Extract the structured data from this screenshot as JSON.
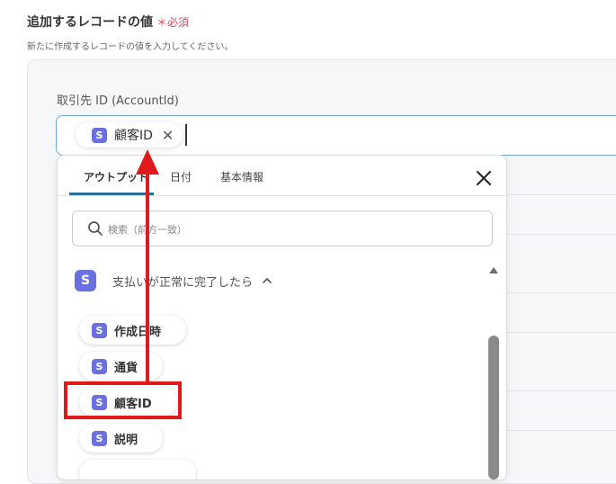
{
  "header": {
    "title": "追加するレコードの値",
    "required_mark": "＊必須",
    "subtitle": "新たに作成するレコードの値を入力してください。"
  },
  "field": {
    "label": "取引先 ID (AccountId)",
    "token": {
      "icon": "S",
      "label": "顧客ID",
      "remove": "✕"
    }
  },
  "dropdown": {
    "tabs": [
      {
        "label": "アウトプット",
        "active": true
      },
      {
        "label": "日付",
        "active": false
      },
      {
        "label": "基本情報",
        "active": false
      }
    ],
    "search_placeholder": "検索（前方一致）",
    "group": {
      "icon": "S",
      "label": "支払いが正常に完了したら",
      "expanded": true
    },
    "items": [
      {
        "icon": "S",
        "label": "作成日時"
      },
      {
        "icon": "S",
        "label": "通貨"
      },
      {
        "icon": "S",
        "label": "顧客ID",
        "highlighted": true
      },
      {
        "icon": "S",
        "label": "説明"
      }
    ]
  },
  "colors": {
    "accent": "#2a6f97",
    "brand_icon": "#6b70e0",
    "required": "#e5485c",
    "annotation": "#e0191a"
  }
}
